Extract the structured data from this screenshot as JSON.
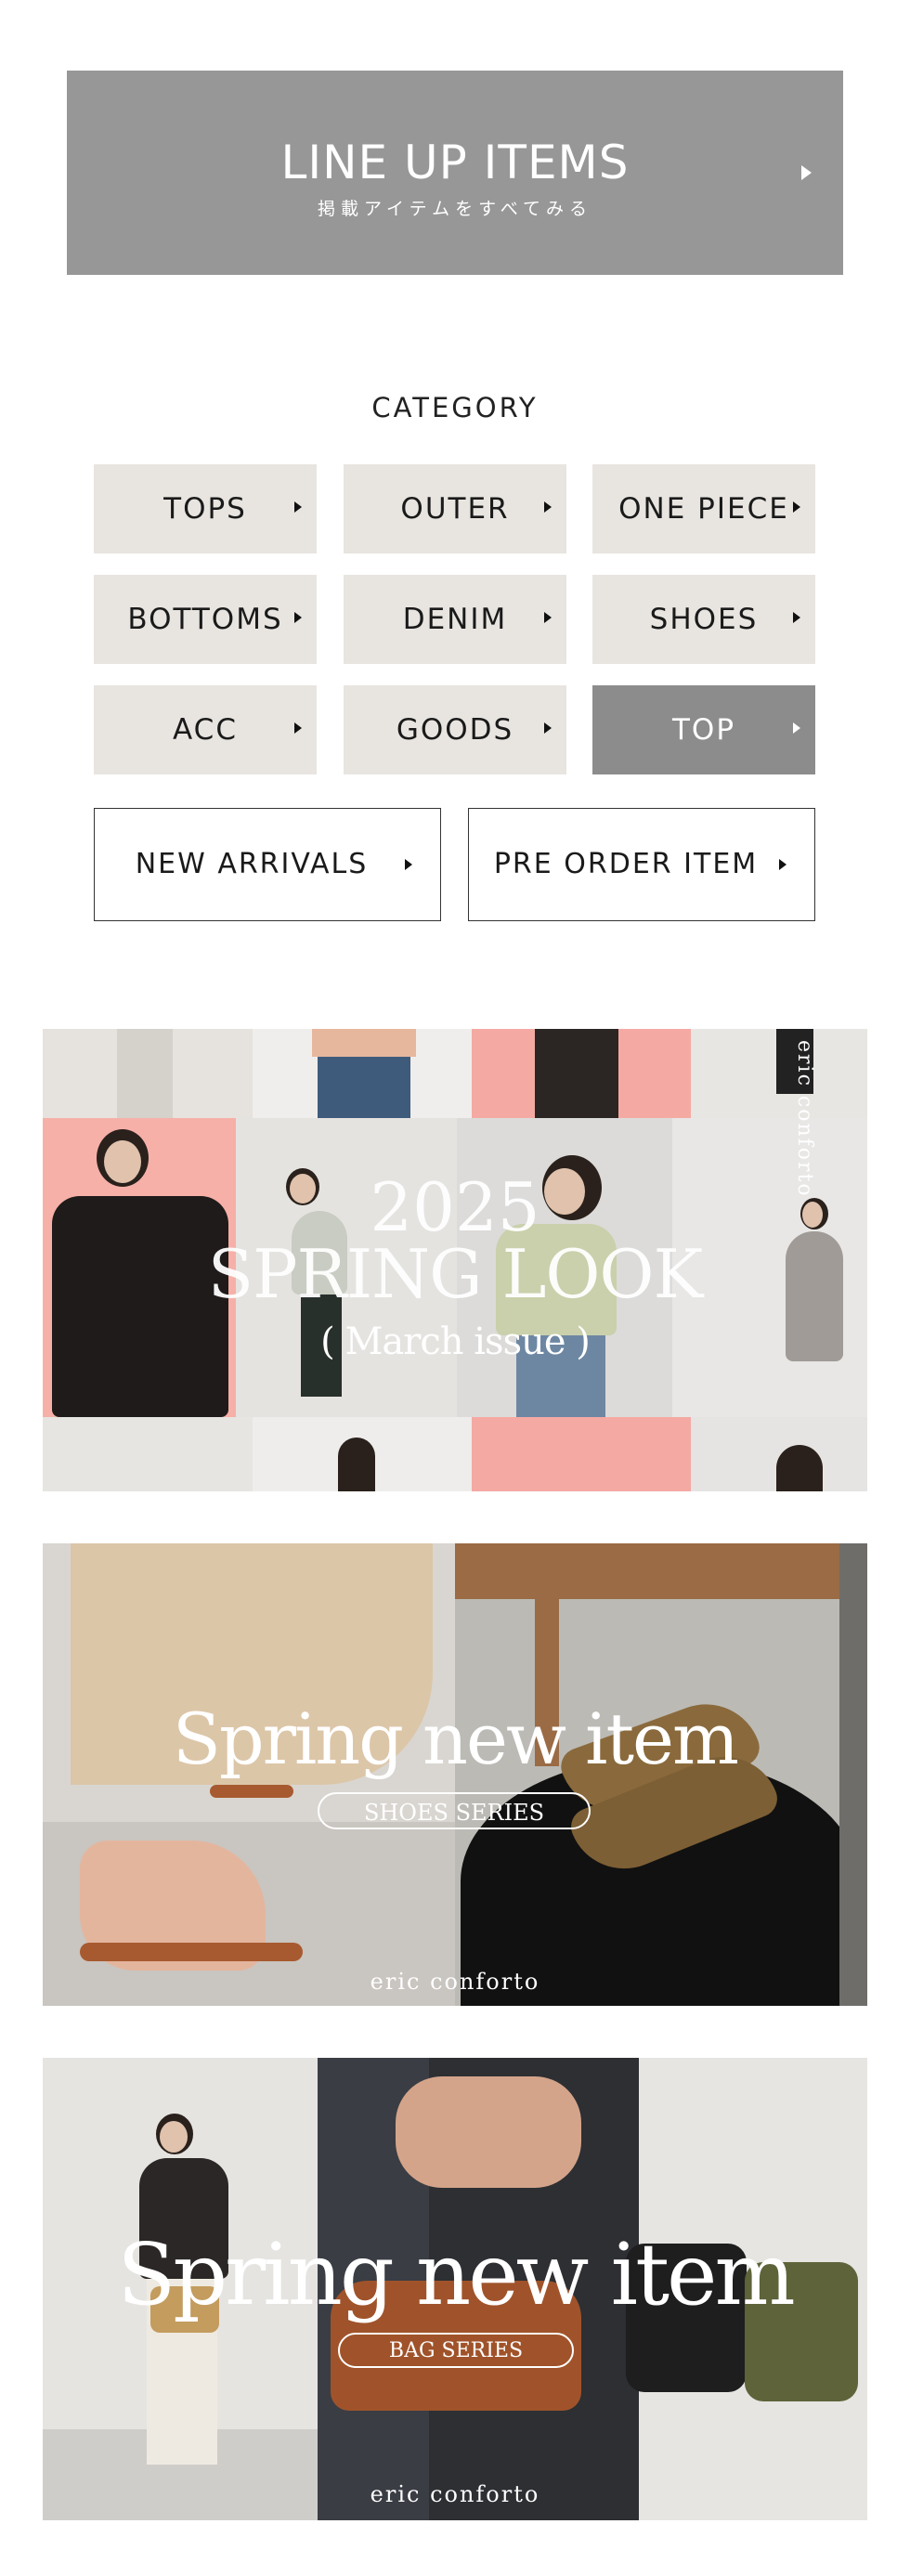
{
  "lineup": {
    "title": "LINE UP ITEMS",
    "subtitle": "掲載アイテムをすべてみる"
  },
  "category": {
    "heading": "CATEGORY",
    "buttons": [
      {
        "label": "TOPS"
      },
      {
        "label": "OUTER"
      },
      {
        "label": "ONE PIECE"
      },
      {
        "label": "BOTTOMS"
      },
      {
        "label": "DENIM"
      },
      {
        "label": "SHOES"
      },
      {
        "label": "ACC"
      },
      {
        "label": "GOODS"
      },
      {
        "label": "TOP"
      }
    ],
    "new_arrivals": "NEW ARRIVALS",
    "pre_order": "PRE ORDER ITEM"
  },
  "banners": {
    "spring_look": {
      "year": "2025",
      "title": "SPRING LOOK",
      "issue": "( March issue )",
      "brand_vertical": "eric conforto"
    },
    "shoes": {
      "title": "Spring new item",
      "series": "SHOES SERIES",
      "brand": "eric conforto"
    },
    "bags": {
      "title": "Spring new item",
      "series": "BAG SERIES",
      "brand": "eric conforto"
    }
  },
  "colors": {
    "lineup_bg": "#979797",
    "category_bg": "#e8e5e1",
    "category_active_bg": "#8c8c8c",
    "pink_accent": "#f2a9a2"
  }
}
